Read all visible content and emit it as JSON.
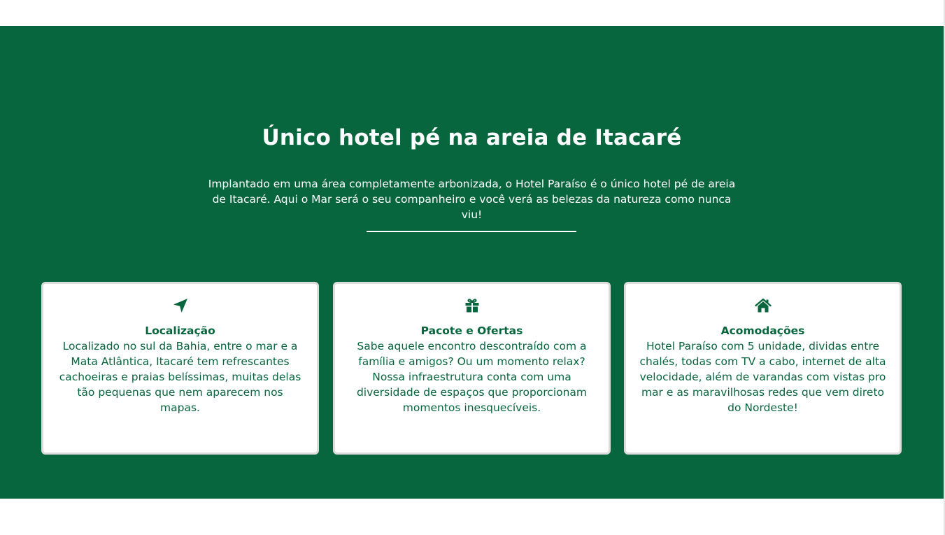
{
  "colors": {
    "brand_green": "#07663d",
    "background": "#ffffff",
    "card_border": "#dcdcdc"
  },
  "hero": {
    "title": "Único hotel pé na areia de Itacaré",
    "text": "Implantado em uma área completamente arbonizada, o Hotel Paraíso é o único hotel pé de areia de Itacaré. Aqui o Mar será o seu companheiro e você verá as belezas da natureza como nunca viu!"
  },
  "cards": [
    {
      "icon": "location-arrow-icon",
      "title": "Localização",
      "text": "Localizado no sul da Bahia, entre o mar e a Mata Atlântica, Itacaré tem refrescantes cachoeiras e praias belíssimas, muitas delas tão pequenas que nem aparecem nos mapas."
    },
    {
      "icon": "gift-icon",
      "title": "Pacote e Ofertas",
      "text": "Sabe aquele encontro descontraído com a família e amigos? Ou um momento relax? Nossa infraestrutura conta com uma diversidade de espaços que proporcionam momentos inesquecíveis."
    },
    {
      "icon": "home-icon",
      "title": "Acomodações",
      "text": "Hotel Paraíso com 5 unidade, dividas entre chalés, todas com TV a cabo, internet de alta velocidade, além de varandas com vistas pro mar e as maravilhosas redes que vem direto do Nordeste!"
    }
  ]
}
